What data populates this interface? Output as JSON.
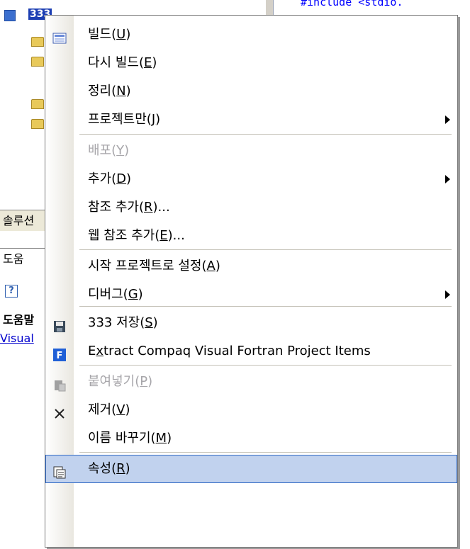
{
  "tree": {
    "project_name": "333"
  },
  "left_panel": {
    "solution_tab": "솔루션",
    "help_tab": "도움",
    "help_title": "도움말",
    "help_link": "Visual"
  },
  "code": {
    "include_line": "#include <stdio."
  },
  "menu": {
    "items": [
      {
        "label": "빌드(U)",
        "pre": "빌드(",
        "key": "U",
        "post": ")"
      },
      {
        "label": "다시 빌드(E)",
        "pre": "다시 빌드(",
        "key": "E",
        "post": ")"
      },
      {
        "label": "정리(N)",
        "pre": "정리(",
        "key": "N",
        "post": ")"
      },
      {
        "label": "프로젝트만(J)",
        "pre": "프로젝트만(",
        "key": "J",
        "post": ")",
        "submenu": true
      },
      {
        "label": "배포(Y)",
        "pre": "배포(",
        "key": "Y",
        "post": ")",
        "disabled": true
      },
      {
        "label": "추가(D)",
        "pre": "추가(",
        "key": "D",
        "post": ")",
        "submenu": true
      },
      {
        "label": "참조 추가(R)...",
        "pre": "참조 추가(",
        "key": "R",
        "post": ")..."
      },
      {
        "label": "웹 참조 추가(E)...",
        "pre": "웹 참조 추가(",
        "key": "E",
        "post": ")..."
      },
      {
        "label": "시작 프로젝트로 설정(A)",
        "pre": "시작 프로젝트로 설정(",
        "key": "A",
        "post": ")"
      },
      {
        "label": "디버그(G)",
        "pre": "디버그(",
        "key": "G",
        "post": ")",
        "submenu": true
      },
      {
        "label": "333 저장(S)",
        "pre": "333 저장(",
        "key": "S",
        "post": ")",
        "icon": "save-icon"
      },
      {
        "label": "Extract Compaq Visual Fortran Project Items",
        "pre": "E",
        "key": "x",
        "post": "tract Compaq Visual Fortran Project Items",
        "icon": "fortran-icon"
      },
      {
        "label": "붙여넣기(P)",
        "pre": "붙여넣기(",
        "key": "P",
        "post": ")",
        "disabled": true,
        "icon": "paste-icon"
      },
      {
        "label": "제거(V)",
        "pre": "제거(",
        "key": "V",
        "post": ")",
        "icon": "remove-icon"
      },
      {
        "label": "이름 바꾸기(M)",
        "pre": "이름 바꾸기(",
        "key": "M",
        "post": ")"
      },
      {
        "label": "속성(R)",
        "pre": "속성(",
        "key": "R",
        "post": ")",
        "icon": "properties-icon",
        "highlighted": true
      }
    ]
  },
  "colors": {
    "highlight": "#c1d2ee",
    "highlight_border": "#316ac5",
    "fortran_icon": "#1f5fd6"
  }
}
